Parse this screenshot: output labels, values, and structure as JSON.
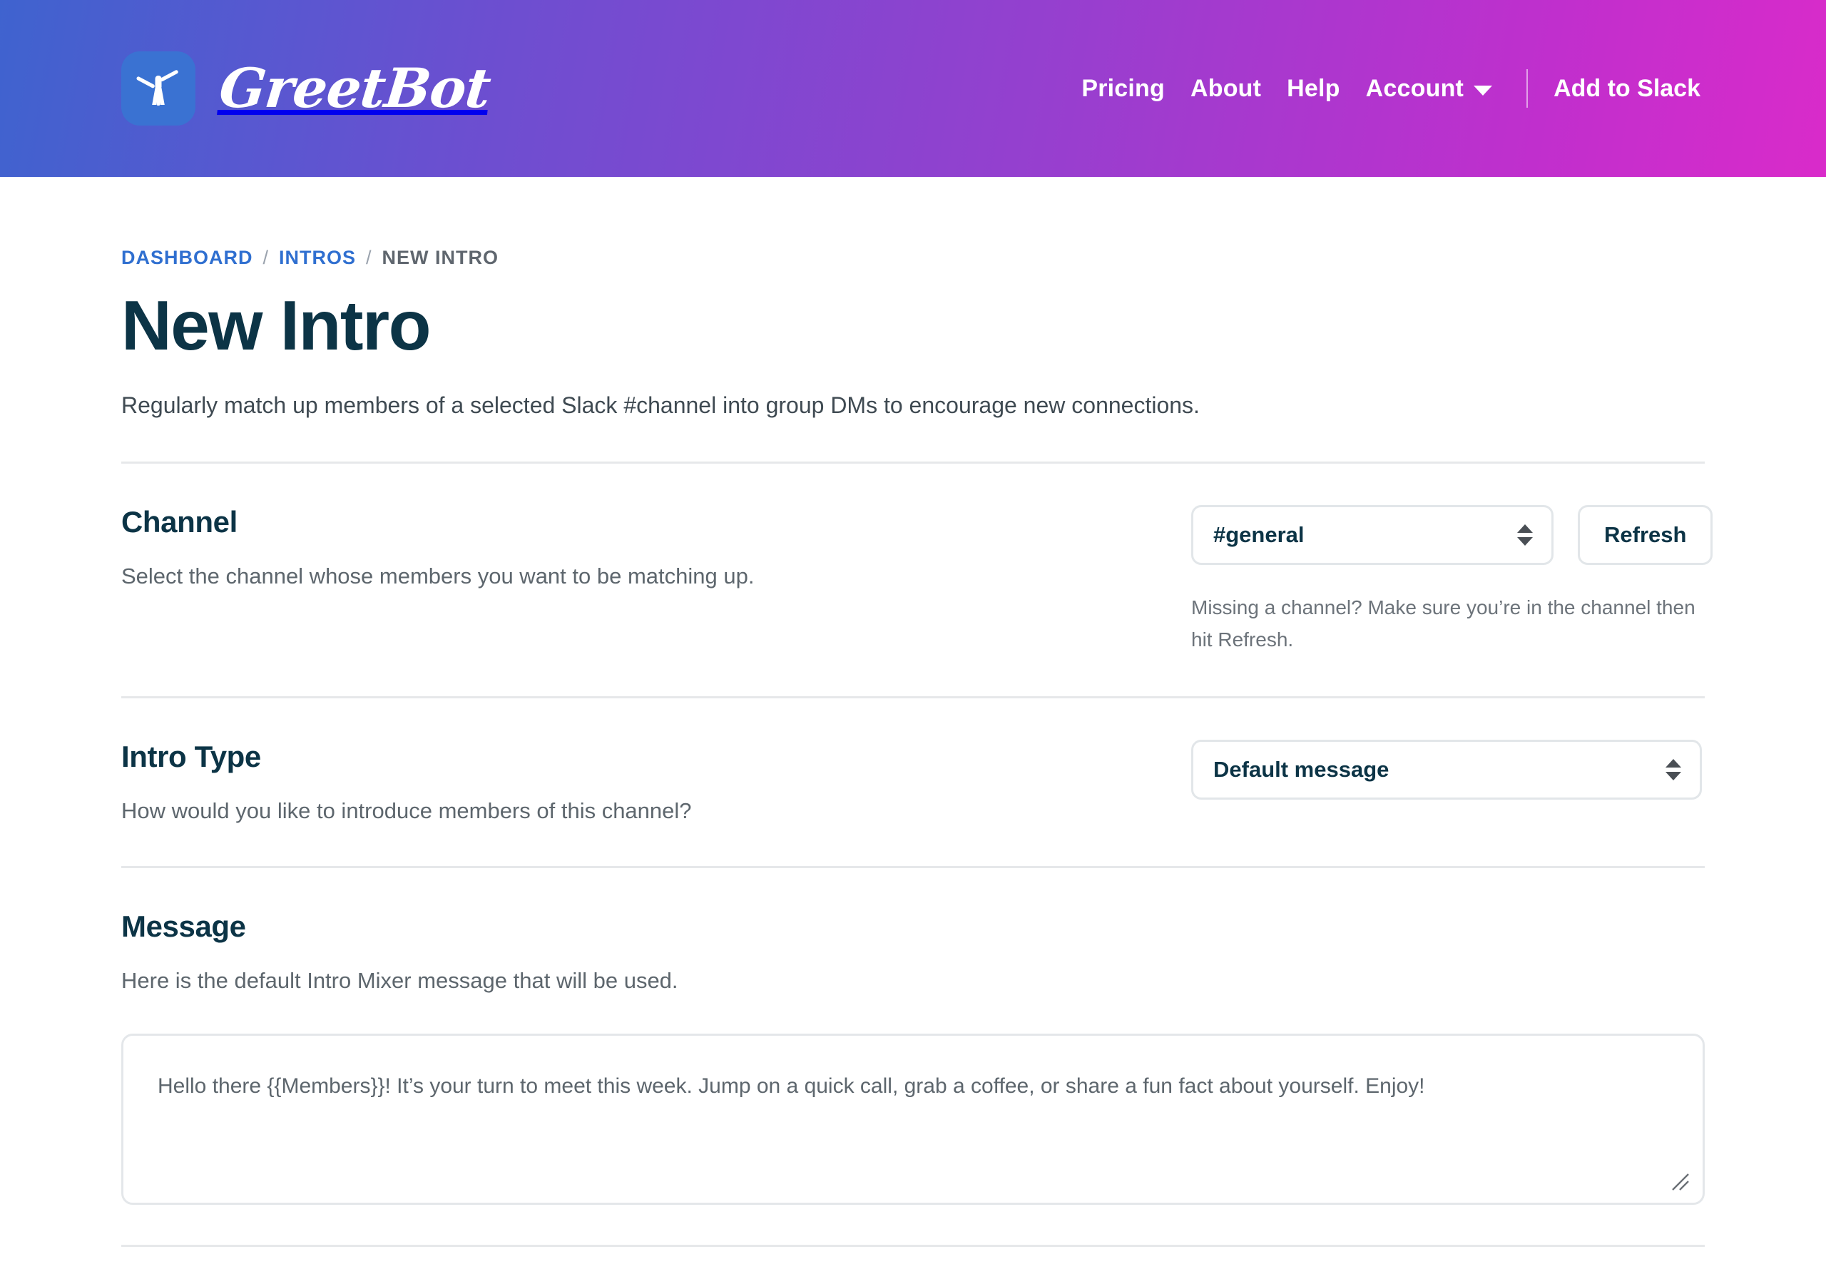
{
  "header": {
    "logo_icon": "person-arms-up-icon",
    "brand_name": "GreetBot",
    "nav": [
      {
        "label": "Pricing",
        "name": "nav-pricing"
      },
      {
        "label": "About",
        "name": "nav-about"
      },
      {
        "label": "Help",
        "name": "nav-help"
      }
    ],
    "account_label": "Account",
    "cta_label": "Add to Slack",
    "gradient_start": "#3f63cf",
    "gradient_end": "#d92bca"
  },
  "breadcrumb": {
    "items": [
      {
        "label": "DASHBOARD",
        "link": true
      },
      {
        "label": "INTROS",
        "link": true
      },
      {
        "label": "NEW INTRO",
        "link": false
      }
    ],
    "separator": "/",
    "link_color": "#2f6fd0"
  },
  "page": {
    "title": "New Intro",
    "subtitle": "Regularly match up members of a selected Slack #channel into group DMs to encourage new connections.",
    "title_color": "#0c3446"
  },
  "channel_section": {
    "title": "Channel",
    "description": "Select the channel whose members you want to be matching up.",
    "select_value": "#general",
    "refresh_label": "Refresh",
    "hint": "Missing a channel? Make sure you’re in the channel then hit Refresh."
  },
  "intro_type_section": {
    "title": "Intro Type",
    "description": "How would you like to introduce members of this channel?",
    "select_value": "Default message"
  },
  "message_section": {
    "title": "Message",
    "description": "Here is the default Intro Mixer message that will be used.",
    "textarea_value": "Hello there {{Members}}! It’s your turn to meet this week. Jump on a quick call, grab a coffee, or share a fun fact about yourself. Enjoy!"
  }
}
